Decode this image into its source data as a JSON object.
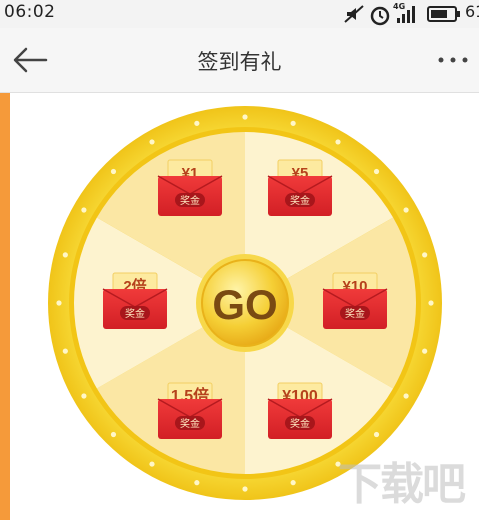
{
  "status_bar": {
    "time": "06:02",
    "network": "4G",
    "battery_text": "61"
  },
  "nav": {
    "title": "签到有礼"
  },
  "wheel": {
    "center_label": "GO",
    "envelope_tag": "奖金",
    "prizes": [
      {
        "label": "¥1"
      },
      {
        "label": "¥5"
      },
      {
        "label": "¥10"
      },
      {
        "label": "¥100"
      },
      {
        "label": "1.5倍"
      },
      {
        "label": "2倍"
      }
    ],
    "colors": {
      "rim": "#f6d021",
      "sector_light": "#fdf3cf",
      "sector_dark": "#fbe9a8",
      "envelope": "#e8262e",
      "center": "#f3c11c"
    }
  },
  "watermark": "下载吧"
}
